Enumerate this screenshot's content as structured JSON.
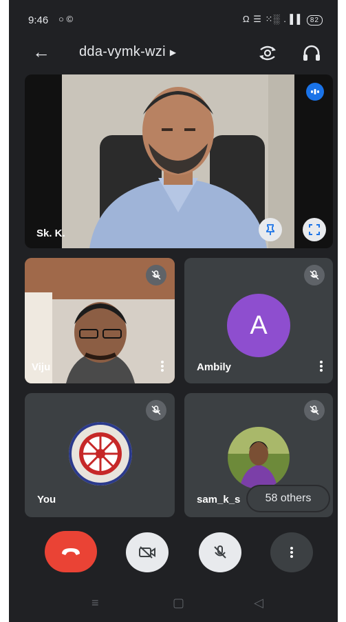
{
  "status_bar": {
    "time": "9:46",
    "left_icons": "○ ©",
    "right_icons": "Ω ☰ ⁙░ .▐▐",
    "battery": "82"
  },
  "app_bar": {
    "meeting_code": "dda-vymk-wzi",
    "dropdown_arrow": "▶"
  },
  "main_tile": {
    "name": "Sk. K."
  },
  "tiles": {
    "viju": {
      "name": "Viju"
    },
    "ambily": {
      "name": "Ambily",
      "avatar_letter": "A",
      "avatar_color": "#8e4ecf"
    },
    "you": {
      "name": "You"
    },
    "sam": {
      "name": "sam_k_s",
      "others_label": "58 others"
    }
  },
  "colors": {
    "background": "#202124",
    "tile": "#3c4043",
    "end_call": "#ea4335",
    "speaking_indicator": "#1a73e8"
  },
  "icons": {
    "back": "arrow-back-icon",
    "switch_camera": "switch-camera-icon",
    "audio": "headphones-icon",
    "speaking": "audio-level-icon",
    "pin": "pin-icon",
    "fullscreen": "fullscreen-icon",
    "mic_off": "mic-off-icon",
    "camera_off": "camera-off-icon",
    "end_call": "end-call-icon",
    "more": "more-vert-icon"
  }
}
